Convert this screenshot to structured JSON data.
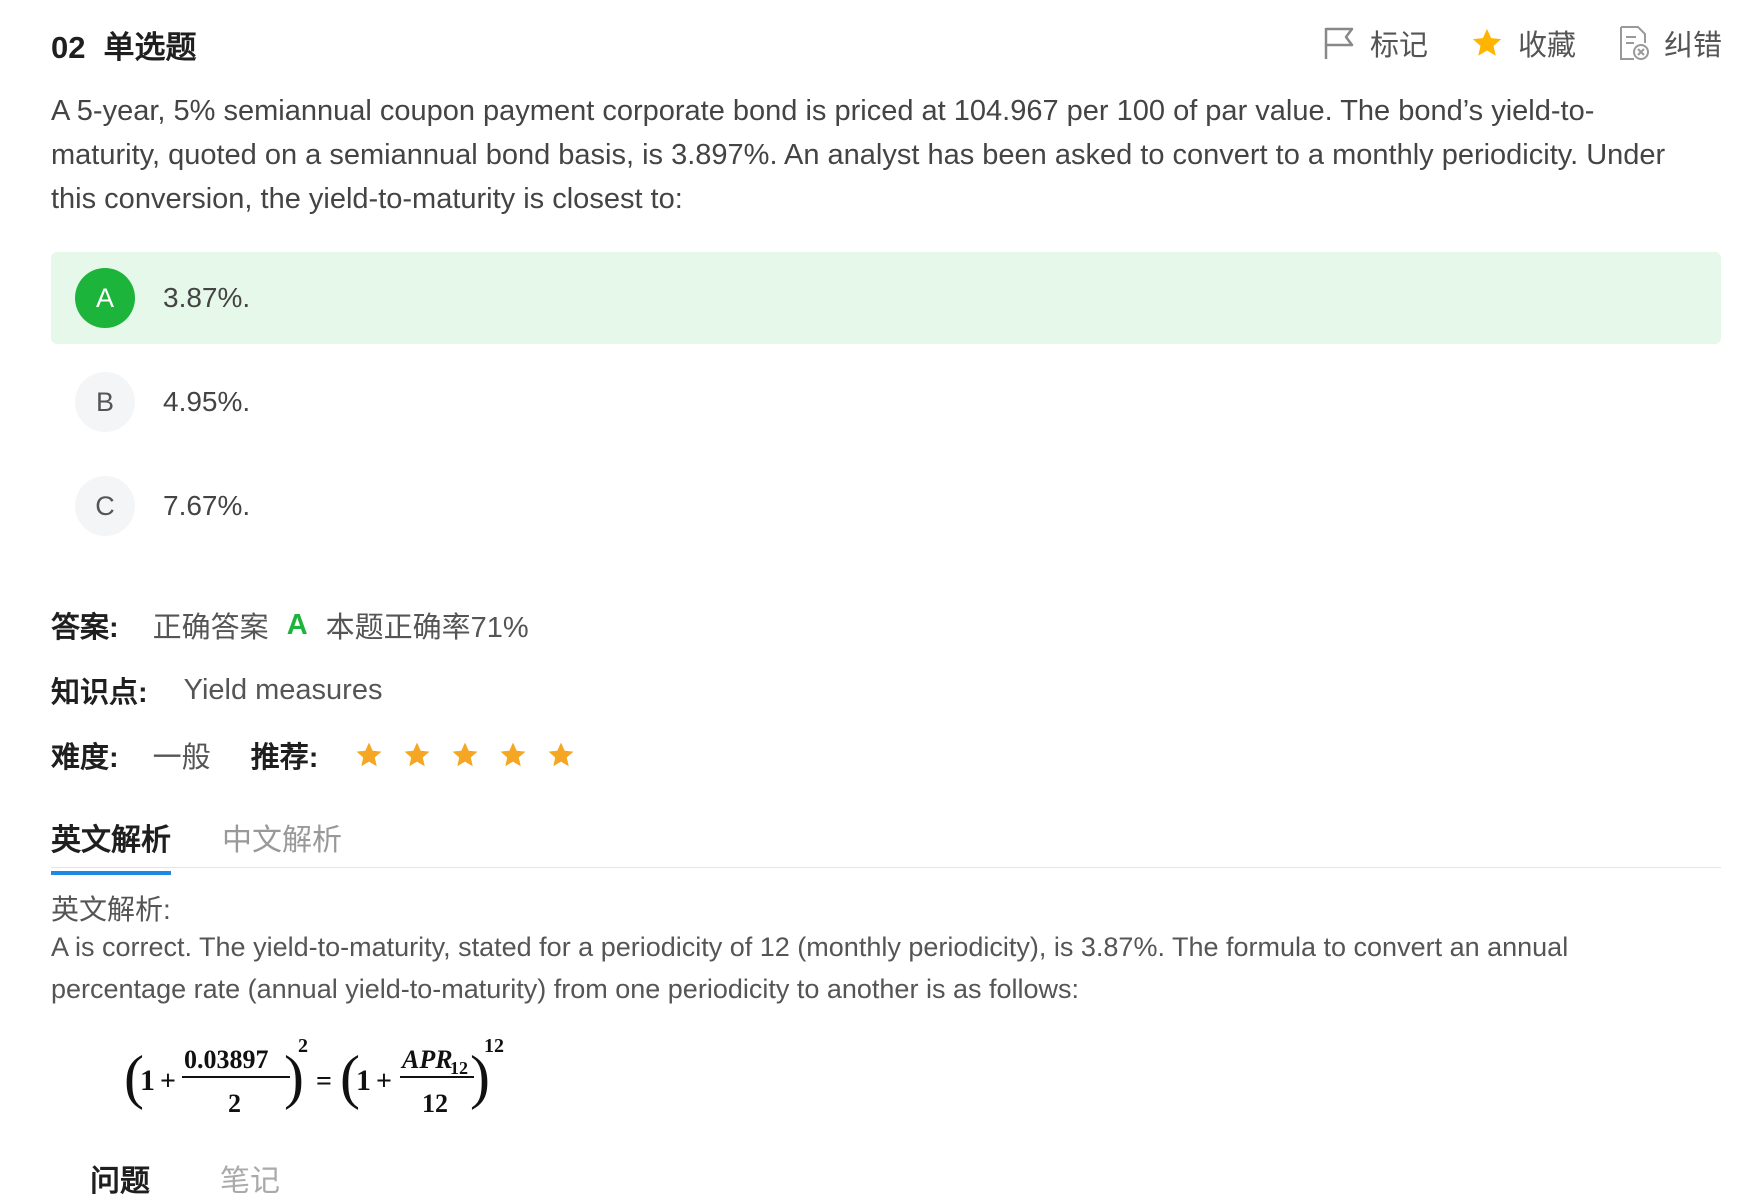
{
  "question": {
    "number": "02",
    "type": "单选题",
    "text": "A 5-year, 5% semiannual coupon payment corporate bond is priced at 104.967 per 100 of par value. The bond’s yield-to-maturity, quoted on a semiannual bond basis, is 3.897%. An analyst has been asked to convert to a monthly periodicity. Under this conversion, the yield-to-maturity is closest to:"
  },
  "toolbar": {
    "mark_label": "标记",
    "favorite_label": "收藏",
    "report_label": "纠错",
    "icons": [
      "flag-icon",
      "star-icon",
      "report-document-icon"
    ],
    "favorite_color": "#ffb400"
  },
  "options": [
    {
      "letter": "A",
      "text": "3.87%.",
      "selected": true
    },
    {
      "letter": "B",
      "text": "4.95%.",
      "selected": false
    },
    {
      "letter": "C",
      "text": "7.67%.",
      "selected": false
    }
  ],
  "answer": {
    "label": "答案:",
    "correct_prefix": "正确答案",
    "correct_letter": "A",
    "accuracy_text": "本题正确率71%"
  },
  "knowledge": {
    "label": "知识点:",
    "value": "Yield measures"
  },
  "difficulty": {
    "label": "难度:",
    "value": "一般",
    "recommend_label": "推荐:",
    "stars": 5,
    "star_color": "#f5a623"
  },
  "tabs": [
    {
      "label": "英文解析",
      "active": true
    },
    {
      "label": "中文解析",
      "active": false
    }
  ],
  "explanation": {
    "title": "英文解析:",
    "body": "A is correct. The yield-to-maturity, stated for a periodicity of 12 (monthly periodicity), is 3.87%. The formula to convert an annual percentage rate (annual yield-to-maturity) from one periodicity to another is as follows:",
    "formula": {
      "one": "1",
      "plus": "+",
      "numerator_left": "0.03897",
      "denominator_left": "2",
      "exponent_left": "2",
      "equals": "=",
      "numerator_right": "APR",
      "numerator_right_sub": "12",
      "denominator_right": "12",
      "exponent_right": "12"
    }
  },
  "bottom_tabs": [
    "问题",
    "笔记"
  ],
  "colors": {
    "accent_blue": "#1e88e5",
    "correct_green": "#1db43c",
    "selected_bg": "#e6f8ea"
  }
}
